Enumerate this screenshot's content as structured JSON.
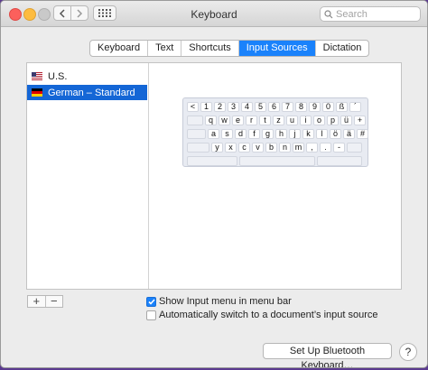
{
  "window": {
    "title": "Keyboard"
  },
  "search": {
    "placeholder": "Search",
    "value": ""
  },
  "tabs": [
    {
      "label": "Keyboard",
      "active": false
    },
    {
      "label": "Text",
      "active": false
    },
    {
      "label": "Shortcuts",
      "active": false
    },
    {
      "label": "Input Sources",
      "active": true
    },
    {
      "label": "Dictation",
      "active": false
    }
  ],
  "sources": [
    {
      "label": "U.S.",
      "flag": "us-flag-icon",
      "selected": false
    },
    {
      "label": "German – Standard",
      "flag": "german-flag-icon",
      "selected": true
    }
  ],
  "keyboard": {
    "rows": [
      [
        "<",
        "1",
        "2",
        "3",
        "4",
        "5",
        "6",
        "7",
        "8",
        "9",
        "0",
        "ß",
        "´"
      ],
      [
        "q",
        "w",
        "e",
        "r",
        "t",
        "z",
        "u",
        "i",
        "o",
        "p",
        "ü",
        "+"
      ],
      [
        "a",
        "s",
        "d",
        "f",
        "g",
        "h",
        "j",
        "k",
        "l",
        "ö",
        "ä",
        "#"
      ],
      [
        "y",
        "x",
        "c",
        "v",
        "b",
        "n",
        "m",
        ",",
        ".",
        "-"
      ]
    ]
  },
  "controls": {
    "add_label": "+",
    "remove_label": "−",
    "show_input_menu": {
      "label": "Show Input menu in menu bar",
      "checked": true
    },
    "auto_switch": {
      "label": "Automatically switch to a document’s input source",
      "checked": false
    },
    "bluetooth_label": "Set Up Bluetooth Keyboard…",
    "help_label": "?"
  },
  "colors": {
    "accent": "#1a82fb",
    "selection": "#1466d6"
  }
}
